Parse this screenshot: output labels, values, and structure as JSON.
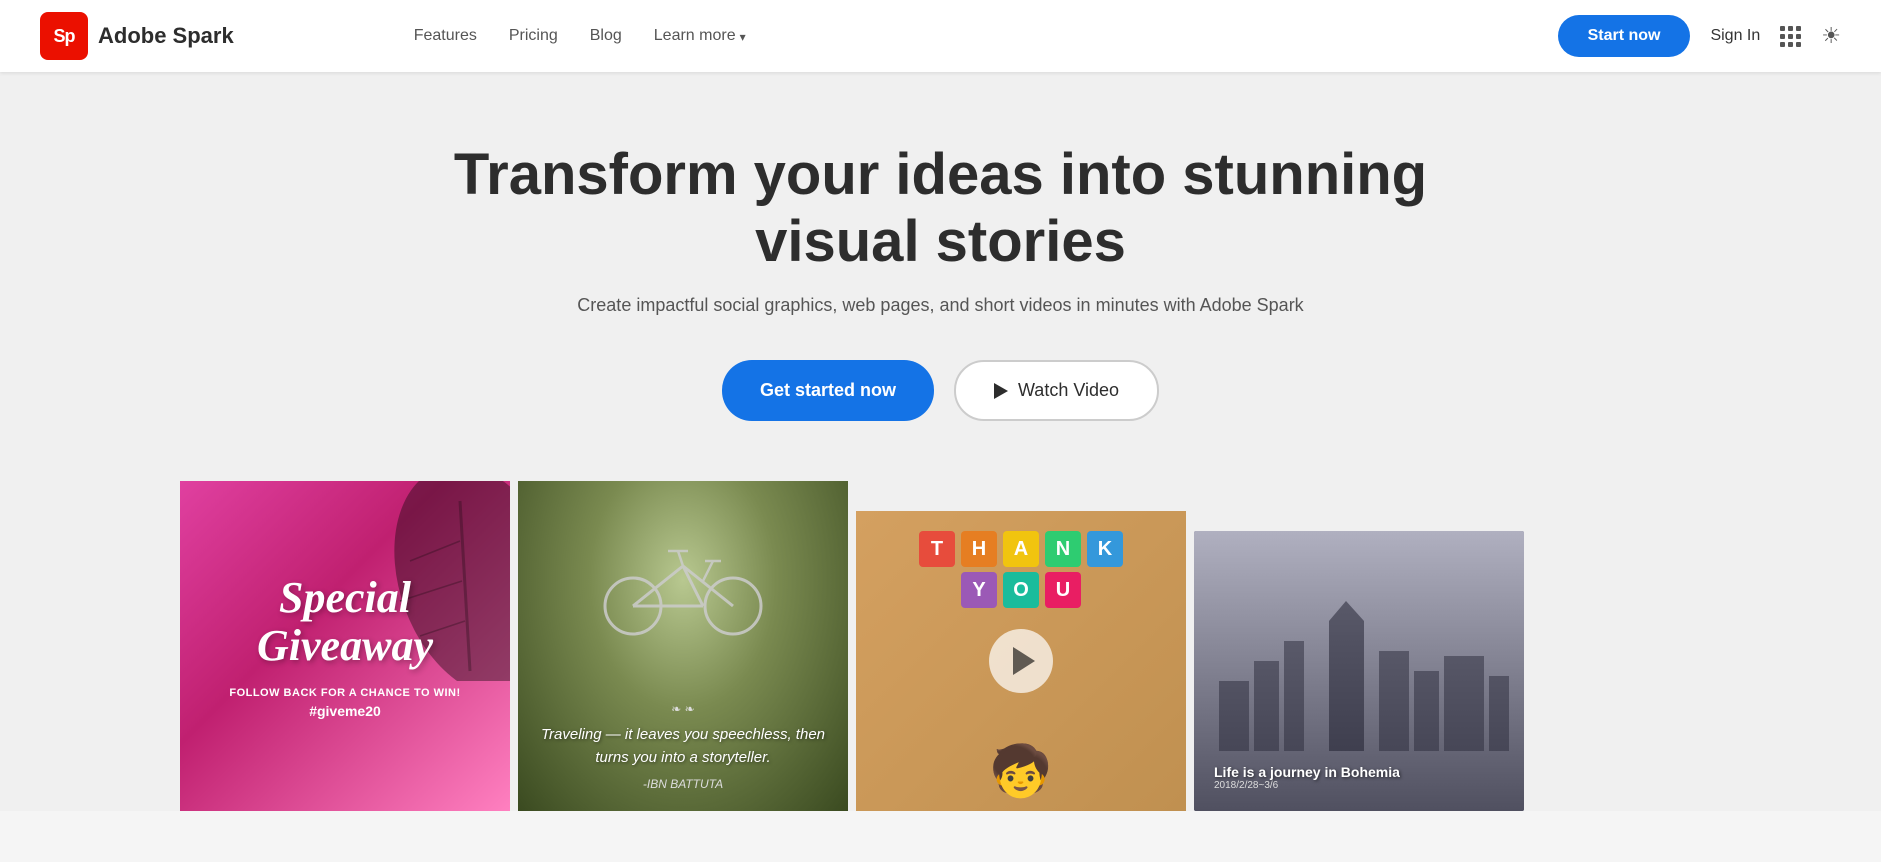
{
  "brand": {
    "logo_short": "Sp",
    "logo_full": "Adobe Spark"
  },
  "nav": {
    "links": [
      {
        "label": "Features",
        "id": "features",
        "has_dropdown": false
      },
      {
        "label": "Pricing",
        "id": "pricing",
        "has_dropdown": false
      },
      {
        "label": "Blog",
        "id": "blog",
        "has_dropdown": false
      },
      {
        "label": "Learn more",
        "id": "learn-more",
        "has_dropdown": true
      }
    ],
    "sign_in": "Sign In",
    "start_now": "Start now"
  },
  "hero": {
    "title": "Transform your ideas into stunning visual stories",
    "subtitle": "Create impactful social graphics, web pages, and short videos in minutes with Adobe Spark",
    "cta_primary": "Get started now",
    "cta_secondary": "Watch Video"
  },
  "gallery": {
    "card1": {
      "line1": "Special",
      "line2": "Giveaway",
      "sub": "FOLLOW BACK FOR A CHANCE TO WIN!",
      "hashtag": "#giveme20"
    },
    "card2": {
      "quote": "Traveling — it leaves you speechless, then turns you into a storyteller.",
      "author": "-IBN BATTUTA"
    },
    "card3": {
      "top_row": [
        "T",
        "H",
        "A",
        "N",
        "K"
      ],
      "bottom_row": [
        "Y",
        "O",
        "U"
      ],
      "colors_top": [
        "#e74c3c",
        "#e67e22",
        "#f1c40f",
        "#2ecc71",
        "#3498db"
      ],
      "colors_bottom": [
        "#9b59b6",
        "#1abc9c",
        "#e91e63"
      ]
    },
    "card4": {
      "title": "Life is a journey in Bohemia",
      "date": "2018/2/28~3/6"
    }
  },
  "colors": {
    "primary_blue": "#1473e6",
    "brand_red": "#eb1000",
    "text_dark": "#2d2d2d",
    "text_muted": "#555555",
    "bg_hero": "#f0f0f0"
  }
}
